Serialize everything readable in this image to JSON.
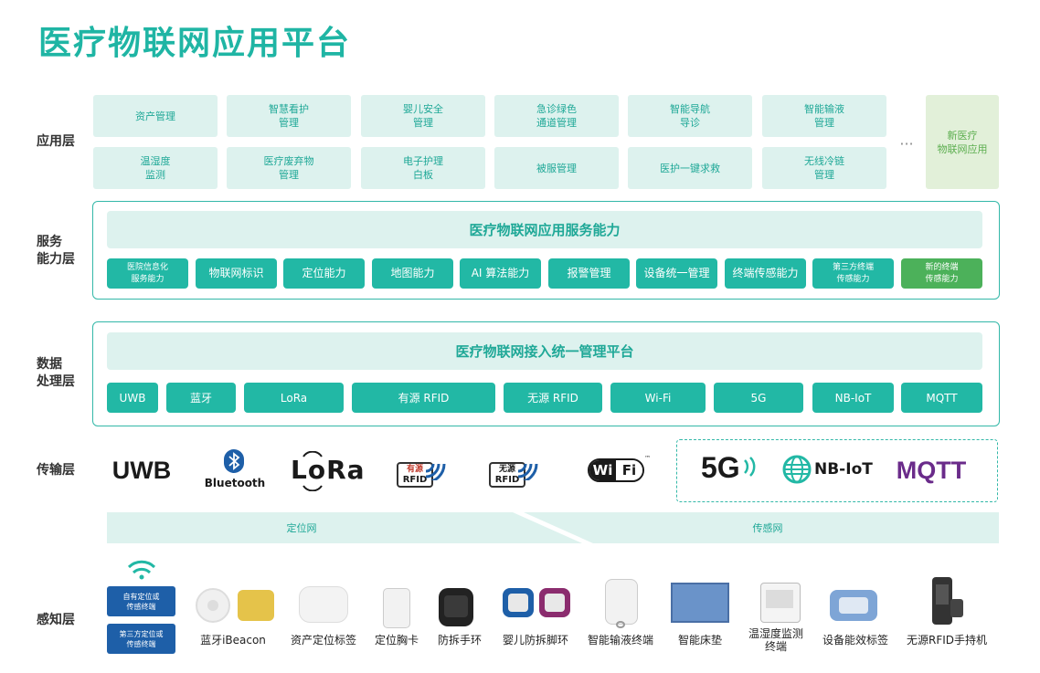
{
  "title": "医疗物联网应用平台",
  "layers": {
    "application": "应用层",
    "service": "服务\n能力层",
    "data": "数据\n处理层",
    "transport": "传输层",
    "perception": "感知层"
  },
  "apps": [
    "资产管理",
    "智慧看护\n管理",
    "婴儿安全\n管理",
    "急诊绿色\n通道管理",
    "智能导航\n导诊",
    "智能输液\n管理",
    "温湿度\n监测",
    "医疗废弃物\n管理",
    "电子护理\n白板",
    "被服管理",
    "医护一键求救",
    "无线冷链\n管理"
  ],
  "app_ellipsis": "···",
  "app_new": "新医疗\n物联网应用",
  "service_banner": "医疗物联网应用服务能力",
  "capabilities": [
    "医院信息化\n服务能力",
    "物联网标识",
    "定位能力",
    "地图能力",
    "AI 算法能力",
    "报警管理",
    "设备统一管理",
    "终端传感能力",
    "第三方终端\n传感能力",
    "新的终端\n传感能力"
  ],
  "data_banner": "医疗物联网接入统一管理平台",
  "protocols": [
    "UWB",
    "蓝牙",
    "LoRa",
    "有源 RFID",
    "无源 RFID",
    "Wi-Fi",
    "5G",
    "NB-IoT",
    "MQTT"
  ],
  "transport_logos": {
    "uwb": "UWB",
    "bluetooth": "Bluetooth",
    "lora": "LoRa",
    "rfid_active_top": "有源",
    "rfid_active_bottom": "RFID",
    "rfid_passive_top": "无源",
    "rfid_passive_bottom": "RFID",
    "wifi_a": "Wi",
    "wifi_b": "Fi",
    "tm": "™",
    "g5": "5G",
    "nbiot": "NB-IoT",
    "mqtt": "MQTT"
  },
  "networks": {
    "positioning": "定位网",
    "sensing": "传感网"
  },
  "perception_tags": [
    "自有定位或\n传感终端",
    "第三方定位或\n传感终端"
  ],
  "devices": [
    "蓝牙iBeacon",
    "资产定位标签",
    "定位胸卡",
    "防拆手环",
    "婴儿防拆脚环",
    "智能输液终端",
    "智能床垫",
    "温湿度监测\n终端",
    "设备能效标签",
    "无源RFID手持机"
  ],
  "colors": {
    "teal": "#22b8a5",
    "title": "#1fb5a4",
    "light": "#ddf2ee",
    "green": "#4cb15a",
    "blue": "#1e5fa8",
    "mqtt": "#6a2b8a",
    "dark": "#1a1a1a"
  },
  "icons": [
    "bluetooth-icon",
    "rfid-wave-icon",
    "wifi-signal-icon",
    "globe-icon",
    "wireless-icon"
  ]
}
